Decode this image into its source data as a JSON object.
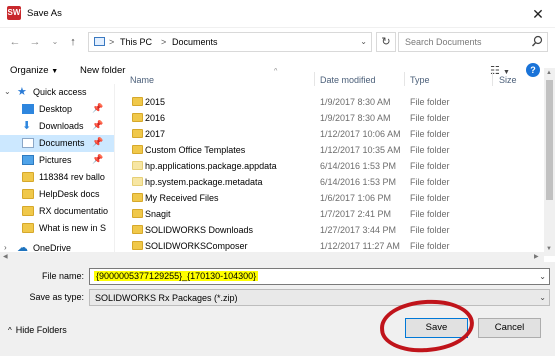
{
  "window": {
    "title": "Save As",
    "app_icon": "solidworks-icon",
    "app_icon_text": "SW"
  },
  "address": {
    "segments": [
      "This PC",
      "Documents"
    ],
    "separator": ">",
    "search_placeholder": "Search Documents"
  },
  "toolbar": {
    "organize_label": "Organize",
    "new_folder_label": "New folder",
    "help_glyph": "?"
  },
  "nav": {
    "items": [
      {
        "label": "Quick access",
        "icon": "star-icon",
        "pinned": false,
        "selected": false
      },
      {
        "label": "Desktop",
        "icon": "desktop-icon",
        "pinned": true,
        "selected": false
      },
      {
        "label": "Downloads",
        "icon": "download-icon",
        "pinned": true,
        "selected": false
      },
      {
        "label": "Documents",
        "icon": "document-icon",
        "pinned": true,
        "selected": true
      },
      {
        "label": "Pictures",
        "icon": "pictures-icon",
        "pinned": true,
        "selected": false
      },
      {
        "label": "118384 rev ballo",
        "icon": "folder-icon",
        "pinned": false,
        "selected": false
      },
      {
        "label": "HelpDesk docs",
        "icon": "folder-icon",
        "pinned": false,
        "selected": false
      },
      {
        "label": "RX documentatio",
        "icon": "folder-icon",
        "pinned": false,
        "selected": false
      },
      {
        "label": "What is new in S",
        "icon": "folder-icon",
        "pinned": false,
        "selected": false
      },
      {
        "label": "OneDrive",
        "icon": "cloud-icon",
        "pinned": false,
        "selected": false
      }
    ]
  },
  "columns": {
    "name": "Name",
    "date": "Date modified",
    "type": "Type",
    "size": "Size"
  },
  "files": [
    {
      "name": "2015",
      "date": "1/9/2017 8:30 AM",
      "type": "File folder",
      "hidden": false
    },
    {
      "name": "2016",
      "date": "1/9/2017 8:30 AM",
      "type": "File folder",
      "hidden": false
    },
    {
      "name": "2017",
      "date": "1/12/2017 10:06 AM",
      "type": "File folder",
      "hidden": false
    },
    {
      "name": "Custom Office Templates",
      "date": "1/12/2017 10:35 AM",
      "type": "File folder",
      "hidden": false
    },
    {
      "name": "hp.applications.package.appdata",
      "date": "6/14/2016 1:53 PM",
      "type": "File folder",
      "hidden": true
    },
    {
      "name": "hp.system.package.metadata",
      "date": "6/14/2016 1:53 PM",
      "type": "File folder",
      "hidden": true
    },
    {
      "name": "My Received Files",
      "date": "1/6/2017 1:06 PM",
      "type": "File folder",
      "hidden": false
    },
    {
      "name": "Snagit",
      "date": "1/7/2017 2:41 PM",
      "type": "File folder",
      "hidden": false
    },
    {
      "name": "SOLIDWORKS Downloads",
      "date": "1/27/2017 3:44 PM",
      "type": "File folder",
      "hidden": false
    },
    {
      "name": "SOLIDWORKSComposer",
      "date": "1/12/2017 11:27 AM",
      "type": "File folder",
      "hidden": false
    }
  ],
  "form": {
    "file_name_label": "File name:",
    "file_name_value": "{9000005377129255}_{170130-104300}",
    "save_type_label": "Save as type:",
    "save_type_value": "SOLIDWORKS Rx Packages (*.zip)"
  },
  "footer": {
    "hide_folders_label": "Hide Folders",
    "save_label": "Save",
    "cancel_label": "Cancel"
  },
  "colors": {
    "selection": "#cce8ff",
    "highlight": "#ffff00",
    "annotation_circle": "#c0141b",
    "accent": "#0078d7"
  }
}
